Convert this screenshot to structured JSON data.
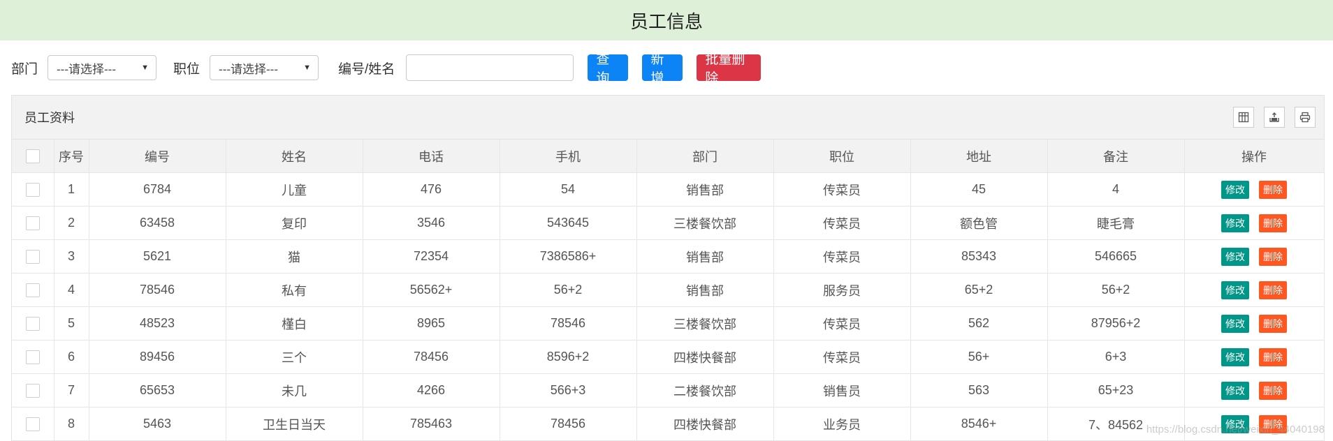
{
  "header": {
    "title": "员工信息"
  },
  "filters": {
    "dept_label": "部门",
    "dept_value": "---请选择---",
    "position_label": "职位",
    "position_value": "---请选择---",
    "id_name_label": "编号/姓名",
    "id_name_value": "",
    "query_button": "查询",
    "add_button": "新增",
    "batch_delete_button": "批量删除"
  },
  "panel": {
    "title": "员工资料",
    "tools": [
      "columns-icon",
      "export-icon",
      "print-icon"
    ]
  },
  "table": {
    "columns": [
      "序号",
      "编号",
      "姓名",
      "电话",
      "手机",
      "部门",
      "职位",
      "地址",
      "备注",
      "操作"
    ],
    "edit_label": "修改",
    "delete_label": "删除",
    "rows": [
      [
        "1",
        "6784",
        "儿童",
        "476",
        "54",
        "销售部",
        "传菜员",
        "45",
        "4"
      ],
      [
        "2",
        "63458",
        "复印",
        "3546",
        "543645",
        "三楼餐饮部",
        "传菜员",
        "额色管",
        "睫毛膏"
      ],
      [
        "3",
        "5621",
        "猫",
        "72354",
        "7386586+",
        "销售部",
        "传菜员",
        "85343",
        "546665"
      ],
      [
        "4",
        "78546",
        "私有",
        "56562+",
        "56+2",
        "销售部",
        "服务员",
        "65+2",
        "56+2"
      ],
      [
        "5",
        "48523",
        "槿白",
        "8965",
        "78546",
        "三楼餐饮部",
        "传菜员",
        "562",
        "87956+2"
      ],
      [
        "6",
        "89456",
        "三个",
        "78456",
        "8596+2",
        "四楼快餐部",
        "传菜员",
        "56+",
        "6+3"
      ],
      [
        "7",
        "65653",
        "未几",
        "4266",
        "566+3",
        "二楼餐饮部",
        "销售员",
        "563",
        "65+23"
      ],
      [
        "8",
        "5463",
        "卫生日当天",
        "785463",
        "78456",
        "四楼快餐部",
        "业务员",
        "8546+",
        "7、84562"
      ]
    ]
  },
  "watermark": "https://blog.csdn.net/weixin_44040198",
  "colors": {
    "header_bg": "#dff0d8",
    "primary_button": "#0d84f5",
    "danger_button": "#dc3545",
    "edit_button": "#009688",
    "delete_button": "#ff5722"
  }
}
